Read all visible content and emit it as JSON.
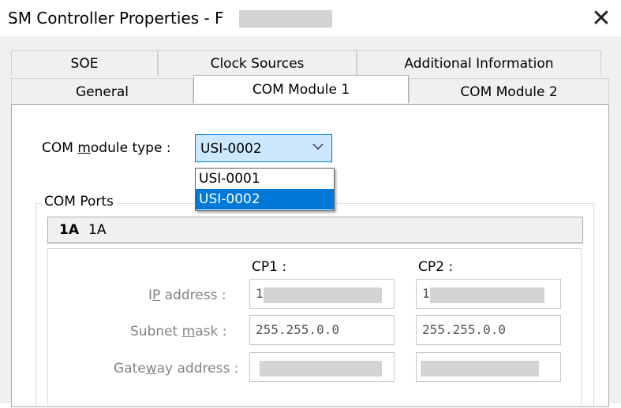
{
  "window": {
    "title": "SM Controller Properties - F",
    "close_glyph": "✕"
  },
  "tabs": {
    "row_back": [
      "SOE",
      "Clock Sources",
      "Additional Information"
    ],
    "row_front": [
      "General",
      "COM Module 1",
      "COM Module 2"
    ],
    "active": "COM Module 1"
  },
  "com_module": {
    "label_prefix": "COM ",
    "label_mnemonic": "m",
    "label_suffix": "odule type :",
    "selected": "USI-0002",
    "options": [
      "USI-0001",
      "USI-0002"
    ]
  },
  "com_ports": {
    "group_title": "COM Ports",
    "subtab_bold": "1A",
    "subtab_text": "1A",
    "cp1_header": "CP1 :",
    "cp2_header": "CP2 :",
    "ip_label_a": "I",
    "ip_label_mnemonic": "P",
    "ip_label_b": " address :",
    "subnet_label_a": "Subnet ",
    "subnet_label_mnemonic": "m",
    "subnet_label_b": "ask :",
    "gateway_label_a": "Gate",
    "gateway_label_mnemonic": "w",
    "gateway_label_b": "ay address :",
    "cp1_ip_visible": "1",
    "cp2_ip_visible": "1",
    "cp1_subnet": "255.255.0.0",
    "cp2_subnet": "255.255.0.0"
  },
  "colors": {
    "accent": "#0078d7",
    "combo_bg": "#cce8ff",
    "disabled_text": "#838383"
  }
}
